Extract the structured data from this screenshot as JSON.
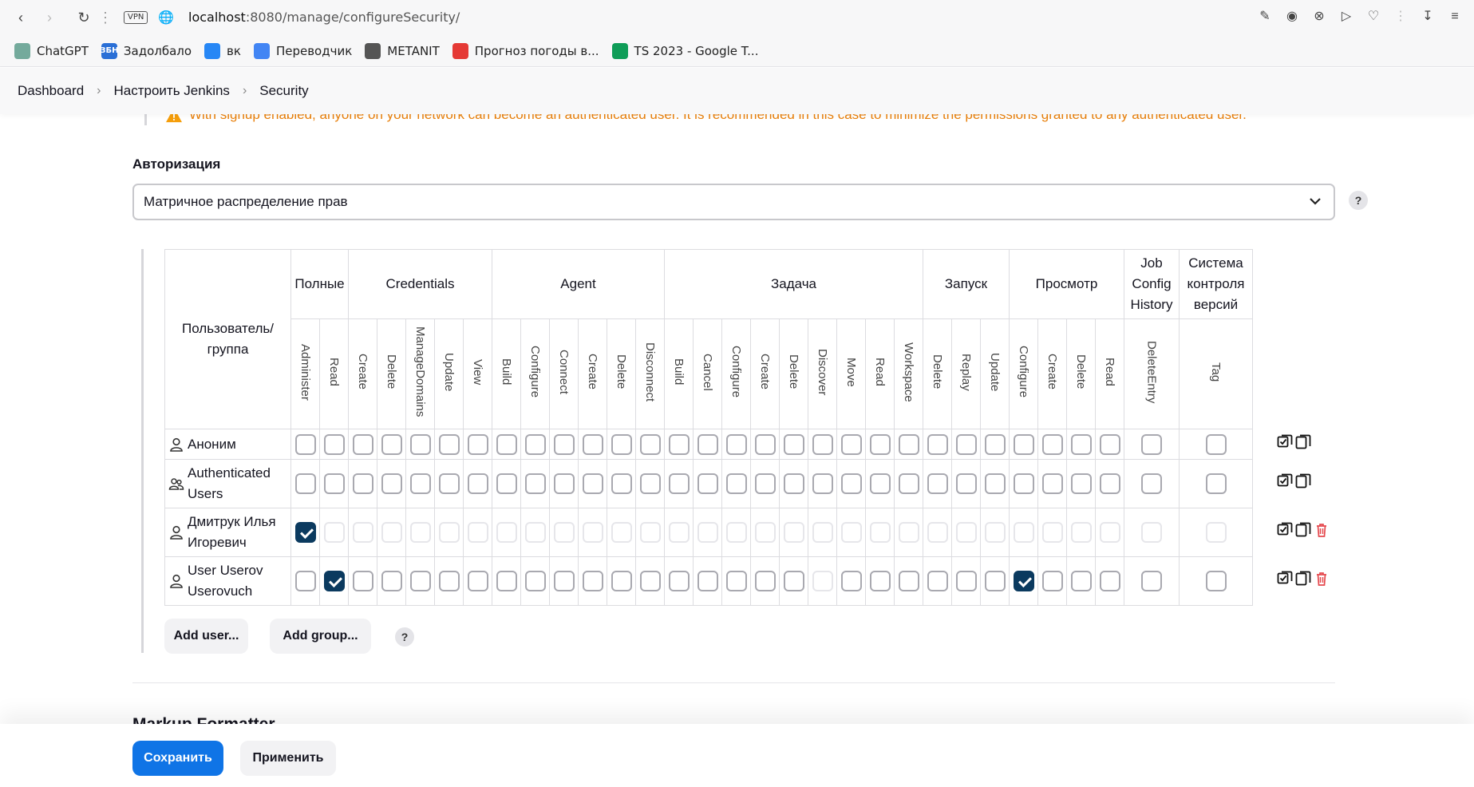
{
  "browser": {
    "vpn_label": "VPN",
    "url_host": "localhost",
    "url_path": ":8080/manage/configureSecurity/"
  },
  "bookmarks": [
    {
      "label": "ChatGPT",
      "icon": "chatgpt-icon",
      "color": "#74aa9c"
    },
    {
      "label": "Задолбало",
      "icon": "zadolbalo-icon",
      "color": "#2a6fd6",
      "text": "ЗБН"
    },
    {
      "label": "вк",
      "icon": "vk-icon",
      "color": "#2787f5"
    },
    {
      "label": "Переводчик",
      "icon": "translate-icon",
      "color": "#4285f4"
    },
    {
      "label": "METANIT",
      "icon": "metanit-icon",
      "color": "#555555"
    },
    {
      "label": "Прогноз погоды в...",
      "icon": "weather-icon",
      "color": "#e53935"
    },
    {
      "label": "TS 2023 - Google T...",
      "icon": "sheets-icon",
      "color": "#0f9d58"
    }
  ],
  "breadcrumb": [
    "Dashboard",
    "Настроить Jenkins",
    "Security"
  ],
  "warning_text": "With signup enabled, anyone on your network can become an authenticated user. It is recommended in this case to minimize the permissions granted to any authenticated user.",
  "authorization": {
    "label": "Авторизация",
    "selected": "Матричное распределение прав"
  },
  "matrix": {
    "user_header": "Пользователь/ группа",
    "groups": [
      {
        "label": "Полные",
        "perms": [
          "Administer",
          "Read"
        ]
      },
      {
        "label": "Credentials",
        "perms": [
          "Create",
          "Delete",
          "ManageDomains",
          "Update",
          "View"
        ]
      },
      {
        "label": "Agent",
        "perms": [
          "Build",
          "Configure",
          "Connect",
          "Create",
          "Delete",
          "Disconnect"
        ]
      },
      {
        "label": "Задача",
        "perms": [
          "Build",
          "Cancel",
          "Configure",
          "Create",
          "Delete",
          "Discover",
          "Move",
          "Read",
          "Workspace"
        ]
      },
      {
        "label": "Запуск",
        "perms": [
          "Delete",
          "Replay",
          "Update"
        ]
      },
      {
        "label": "Просмотр",
        "perms": [
          "Configure",
          "Create",
          "Delete",
          "Read"
        ]
      },
      {
        "label": "Job Config History",
        "perms": [
          "DeleteEntry"
        ]
      },
      {
        "label": "Система контроля версий",
        "perms": [
          "Tag"
        ]
      }
    ],
    "rows": [
      {
        "name": "Аноним",
        "type": "user",
        "checked": [],
        "faint": [],
        "deletable": false
      },
      {
        "name": "Authenticated Users",
        "type": "group",
        "checked": [],
        "faint": [],
        "deletable": false
      },
      {
        "name": "Дмитрук Илья Игоревич",
        "type": "user",
        "checked": [
          0
        ],
        "faint": "all-except-checked",
        "deletable": true
      },
      {
        "name": "User Userov Userovuch",
        "type": "user",
        "checked": [
          1,
          25
        ],
        "faint": [
          18
        ],
        "deletable": true
      }
    ],
    "add_user_label": "Add user...",
    "add_group_label": "Add group..."
  },
  "help_label": "?",
  "next_section_title": "Markup Formatter",
  "buttons": {
    "save": "Сохранить",
    "apply": "Применить"
  },
  "colors": {
    "primary": "#0f74e6",
    "checked": "#0b3a5f",
    "warning": "#e8800c",
    "delete": "#e5484d"
  }
}
